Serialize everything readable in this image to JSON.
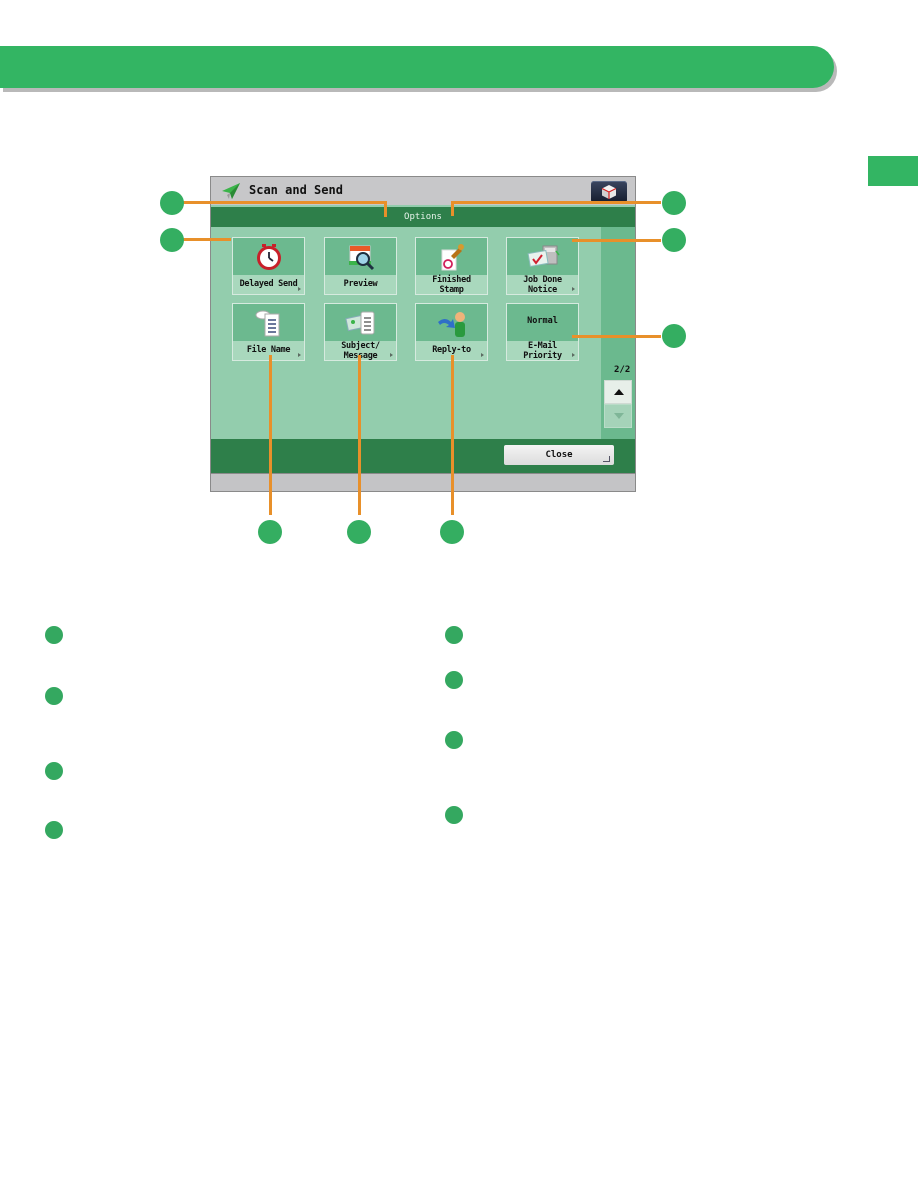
{
  "page": {
    "header_bar_color": "#33b563",
    "callout_color": "#34ae61",
    "leader_line_color": "#e8902a"
  },
  "screen": {
    "app_title": "Scan and Send",
    "app_icon": "paper-plane-icon",
    "menu_button_icon": "cube-menu-icon",
    "section_title": "Options",
    "page_indicator": "2/2",
    "close_label": "Close",
    "tiles": [
      {
        "id": "delayed-send",
        "label": "Delayed Send",
        "icon": "clock-icon",
        "has_submenu": true
      },
      {
        "id": "preview",
        "label": "Preview",
        "icon": "preview-magnifier-icon",
        "has_submenu": false
      },
      {
        "id": "finished-stamp",
        "label_line1": "Finished",
        "label_line2": "Stamp",
        "icon": "stamp-icon",
        "has_submenu": false
      },
      {
        "id": "job-done-notice",
        "label_line1": "Job Done",
        "label_line2": "Notice",
        "icon": "notice-mail-icon",
        "has_submenu": true
      },
      {
        "id": "file-name",
        "label": "File Name",
        "icon": "file-name-icon",
        "has_submenu": true
      },
      {
        "id": "subject-message",
        "label_line1": "Subject/",
        "label_line2": "Message",
        "icon": "subject-message-icon",
        "has_submenu": true
      },
      {
        "id": "reply-to",
        "label": "Reply-to",
        "icon": "reply-to-icon",
        "has_submenu": true
      },
      {
        "id": "email-priority",
        "value": "Normal",
        "label_line1": "E-Mail",
        "label_line2": "Priority",
        "has_submenu": true
      }
    ]
  }
}
